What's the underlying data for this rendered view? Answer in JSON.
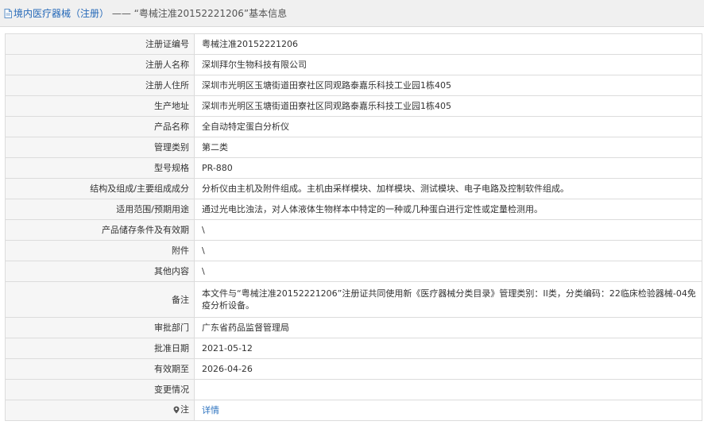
{
  "header": {
    "crumb": "境内医疗器械（注册）",
    "separator": "——",
    "subject": "“粤械注准20152221206”基本信息"
  },
  "rows": [
    {
      "label": "注册证编号",
      "value": "粤械注准20152221206"
    },
    {
      "label": "注册人名称",
      "value": "深圳拜尔生物科技有限公司"
    },
    {
      "label": "注册人住所",
      "value": "深圳市光明区玉塘街道田寮社区同观路泰嘉乐科技工业园1栋405"
    },
    {
      "label": "生产地址",
      "value": "深圳市光明区玉塘街道田寮社区同观路泰嘉乐科技工业园1栋405"
    },
    {
      "label": "产品名称",
      "value": "全自动特定蛋白分析仪"
    },
    {
      "label": "管理类别",
      "value": "第二类"
    },
    {
      "label": "型号规格",
      "value": "PR-880"
    },
    {
      "label": "结构及组成/主要组成成分",
      "value": "分析仪由主机及附件组成。主机由采样模块、加样模块、测试模块、电子电路及控制软件组成。"
    },
    {
      "label": "适用范围/预期用途",
      "value": "通过光电比浊法，对人体液体生物样本中特定的一种或几种蛋白进行定性或定量检测用。"
    },
    {
      "label": "产品储存条件及有效期",
      "value": "\\"
    },
    {
      "label": "附件",
      "value": "\\"
    },
    {
      "label": "其他内容",
      "value": "\\"
    },
    {
      "label": "备注",
      "value": "本文件与“粤械注准20152221206”注册证共同使用新《医疗器械分类目录》管理类别：II类，分类编码：22临床检验器械-04免疫分析设备。"
    },
    {
      "label": "审批部门",
      "value": "广东省药品监督管理局"
    },
    {
      "label": "批准日期",
      "value": "2021-05-12"
    },
    {
      "label": "有效期至",
      "value": "2026-04-26"
    },
    {
      "label": "变更情况",
      "value": ""
    }
  ],
  "note_row": {
    "label": "注",
    "link": "详情",
    "icon": "pin-icon"
  },
  "colors": {
    "link": "#2f74c0",
    "header_bg": "#f0f0f0",
    "label_bg": "#f6f6f6",
    "border": "#dcdcdc"
  }
}
